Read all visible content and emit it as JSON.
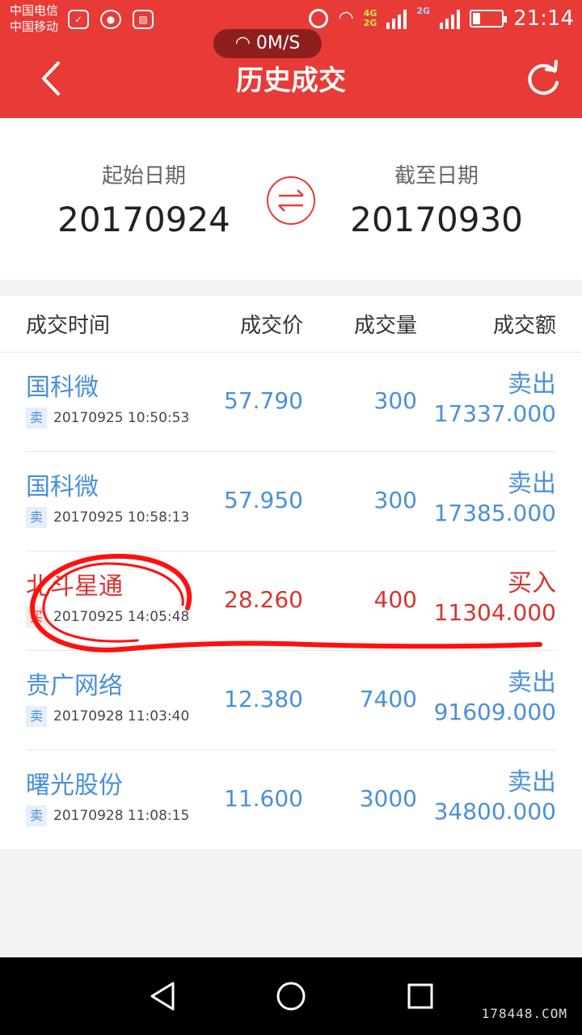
{
  "status_bar": {
    "carrier_1": "中国电信",
    "carrier_2": "中国移动",
    "net_4g": "4G",
    "net_2g_a": "2G",
    "net_2g_b": "2G",
    "time": "21:14"
  },
  "network_speed": "0M/S",
  "header": {
    "title": "历史成交",
    "back_icon": "chevron-left-icon",
    "refresh_icon": "refresh-icon"
  },
  "date_range": {
    "start_label": "起始日期",
    "start_value": "20170924",
    "end_label": "截至日期",
    "end_value": "20170930",
    "swap_icon": "swap-arrows-icon"
  },
  "table": {
    "columns": {
      "time": "成交时间",
      "price": "成交价",
      "quantity": "成交量",
      "amount": "成交额"
    },
    "rows": [
      {
        "name": "国科微",
        "tag": "卖",
        "timestamp": "20170925 10:50:53",
        "price": "57.790",
        "quantity": "300",
        "side": "卖出",
        "amount": "17337.000",
        "type": "sell"
      },
      {
        "name": "国科微",
        "tag": "卖",
        "timestamp": "20170925 10:58:13",
        "price": "57.950",
        "quantity": "300",
        "side": "卖出",
        "amount": "17385.000",
        "type": "sell"
      },
      {
        "name": "北斗星通",
        "tag": "买",
        "timestamp": "20170925 14:05:48",
        "price": "28.260",
        "quantity": "400",
        "side": "买入",
        "amount": "11304.000",
        "type": "buy"
      },
      {
        "name": "贵广网络",
        "tag": "卖",
        "timestamp": "20170928 11:03:40",
        "price": "12.380",
        "quantity": "7400",
        "side": "卖出",
        "amount": "91609.000",
        "type": "sell"
      },
      {
        "name": "曙光股份",
        "tag": "卖",
        "timestamp": "20170928 11:08:15",
        "price": "11.600",
        "quantity": "3000",
        "side": "卖出",
        "amount": "34800.000",
        "type": "sell"
      }
    ]
  },
  "colors": {
    "header_red": "#e83a36",
    "sell_blue": "#4a90d9",
    "buy_red": "#d9342f",
    "annotation_red": "#ff1010"
  },
  "watermark": "178448.COM"
}
